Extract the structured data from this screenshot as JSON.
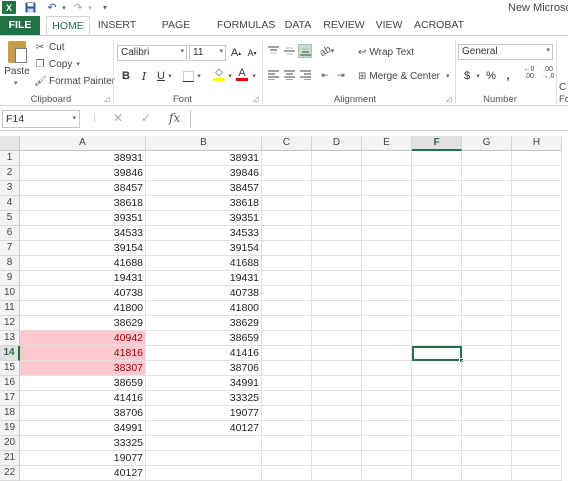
{
  "title_bar": {
    "app_icon": "excel-logo",
    "app_icon_text": "X",
    "window_title": "New Microsoft"
  },
  "tabs": [
    "FILE",
    "HOME",
    "INSERT",
    "PAGE LAYOUT",
    "FORMULAS",
    "DATA",
    "REVIEW",
    "VIEW",
    "ACROBAT"
  ],
  "active_tab": "HOME",
  "ribbon": {
    "clipboard": {
      "paste": "Paste",
      "cut": "Cut",
      "copy": "Copy",
      "format_painter": "Format Painter",
      "label": "Clipboard"
    },
    "font": {
      "name": "Calibri",
      "size": "11",
      "grow": "A",
      "shrink": "A",
      "bold": "B",
      "italic": "I",
      "underline": "U",
      "font_color_glyph": "A",
      "label": "Font"
    },
    "alignment": {
      "wrap_text": "Wrap Text",
      "merge_center": "Merge & Center",
      "label": "Alignment"
    },
    "number": {
      "format": "General",
      "currency": "$",
      "percent": "%",
      "comma": ",",
      "label": "Number"
    },
    "styles_partial_1": "C",
    "styles_partial_2": "Fo"
  },
  "formula_bar": {
    "name_box": "F14",
    "formula": "",
    "fx": "fx"
  },
  "sheet": {
    "columns": [
      "A",
      "B",
      "C",
      "D",
      "E",
      "F",
      "G",
      "H"
    ],
    "selected_column": "F",
    "selected_row": 14,
    "active_cell": "F14",
    "highlight_color": "#ffc7ce",
    "highlight_text_color": "#9c0006",
    "highlighted_cells": [
      "A13",
      "A14",
      "A15"
    ],
    "rows": [
      {
        "row": 1,
        "A": "38931",
        "B": "38931"
      },
      {
        "row": 2,
        "A": "39846",
        "B": "39846"
      },
      {
        "row": 3,
        "A": "38457",
        "B": "38457"
      },
      {
        "row": 4,
        "A": "38618",
        "B": "38618"
      },
      {
        "row": 5,
        "A": "39351",
        "B": "39351"
      },
      {
        "row": 6,
        "A": "34533",
        "B": "34533"
      },
      {
        "row": 7,
        "A": "39154",
        "B": "39154"
      },
      {
        "row": 8,
        "A": "41688",
        "B": "41688"
      },
      {
        "row": 9,
        "A": "19431",
        "B": "19431"
      },
      {
        "row": 10,
        "A": "40738",
        "B": "40738"
      },
      {
        "row": 11,
        "A": "41800",
        "B": "41800"
      },
      {
        "row": 12,
        "A": "38629",
        "B": "38629"
      },
      {
        "row": 13,
        "A": "40942",
        "B": "38659"
      },
      {
        "row": 14,
        "A": "41816",
        "B": "41416"
      },
      {
        "row": 15,
        "A": "38307",
        "B": "38706"
      },
      {
        "row": 16,
        "A": "38659",
        "B": "34991"
      },
      {
        "row": 17,
        "A": "41416",
        "B": "33325"
      },
      {
        "row": 18,
        "A": "38706",
        "B": "19077"
      },
      {
        "row": 19,
        "A": "34991",
        "B": "40127"
      },
      {
        "row": 20,
        "A": "33325",
        "B": ""
      },
      {
        "row": 21,
        "A": "19077",
        "B": ""
      },
      {
        "row": 22,
        "A": "40127",
        "B": ""
      }
    ]
  }
}
